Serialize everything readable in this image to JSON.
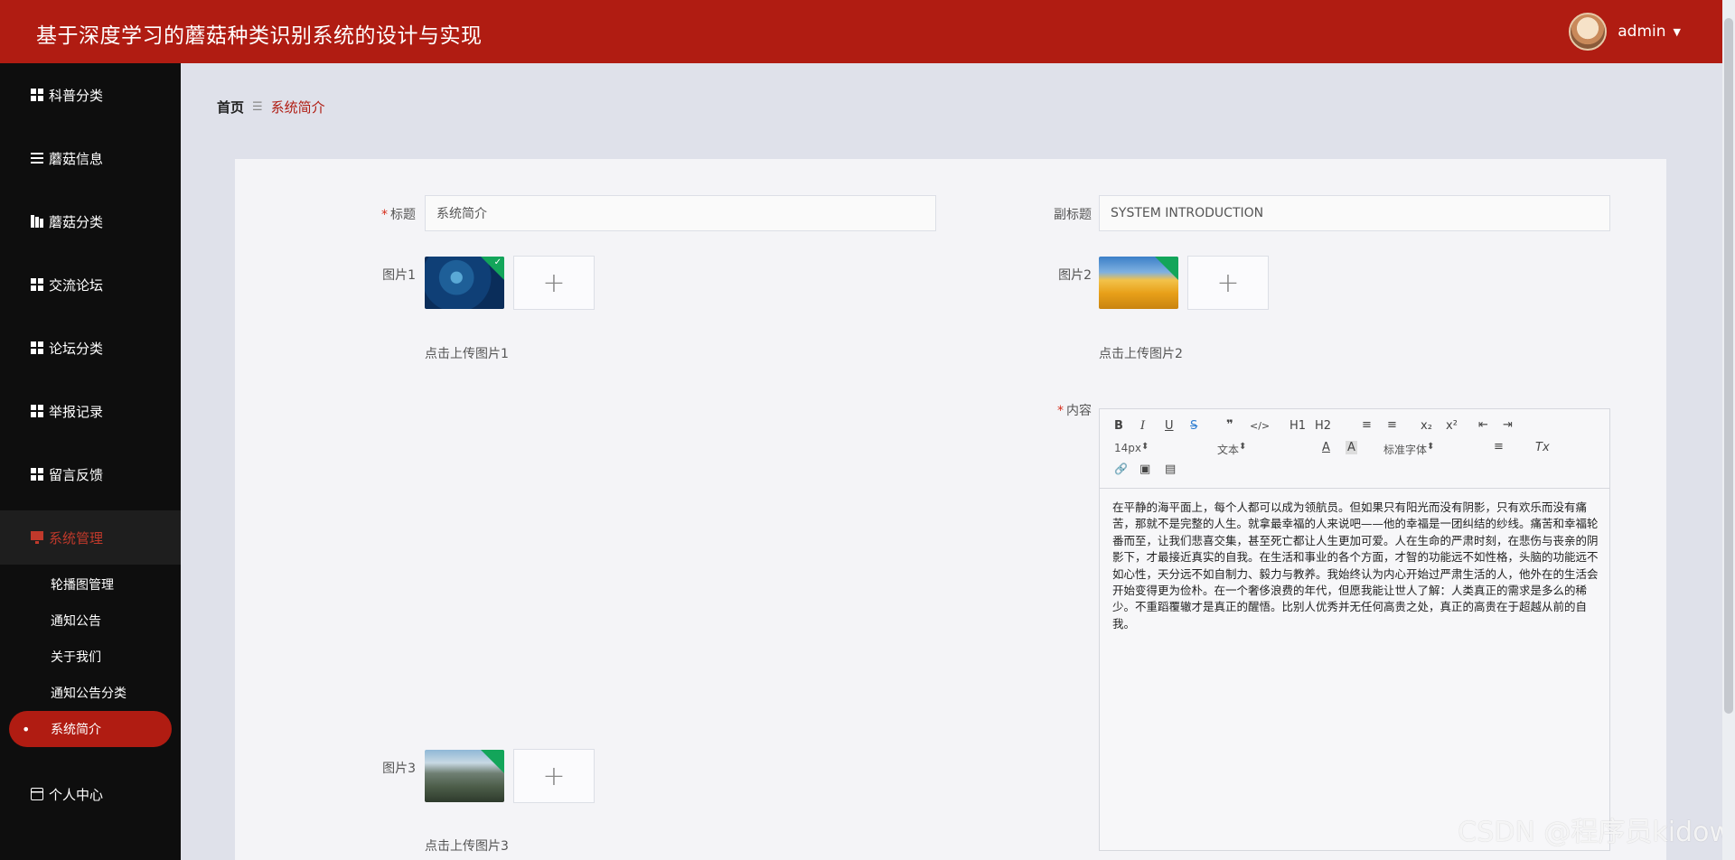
{
  "app": {
    "title": "基于深度学习的蘑菇种类识别系统的设计与实现",
    "user": "admin"
  },
  "sidebar": {
    "items": [
      {
        "label": "科普分类",
        "icon": "grid-icon"
      },
      {
        "label": "蘑菇信息",
        "icon": "list-icon"
      },
      {
        "label": "蘑菇分类",
        "icon": "book-icon"
      },
      {
        "label": "交流论坛",
        "icon": "grid-icon"
      },
      {
        "label": "论坛分类",
        "icon": "grid-icon"
      },
      {
        "label": "举报记录",
        "icon": "grid-icon"
      },
      {
        "label": "留言反馈",
        "icon": "grid-icon"
      },
      {
        "label": "系统管理",
        "icon": "monitor-icon"
      },
      {
        "label": "个人中心",
        "icon": "card-icon"
      }
    ],
    "sub_items": [
      "轮播图管理",
      "通知公告",
      "关于我们",
      "通知公告分类",
      "系统简介"
    ]
  },
  "breadcrumb": {
    "home": "首页",
    "separator": "☰",
    "current": "系统简介"
  },
  "form": {
    "title_label": "标题",
    "title_value": "系统简介",
    "subtitle_label": "副标题",
    "subtitle_value": "SYSTEM INTRODUCTION",
    "image1_label": "图片1",
    "image2_label": "图片2",
    "image3_label": "图片3",
    "image1_hint": "点击上传图片1",
    "image2_hint": "点击上传图片2",
    "image3_hint": "点击上传图片3",
    "content_label": "内容",
    "upload_plus": "+"
  },
  "editor": {
    "font_size": "14px",
    "block_type": "文本",
    "font_family": "标准字体",
    "tools": {
      "bold": "B",
      "italic": "I",
      "underline": "U",
      "strike": "S",
      "quote": "❞",
      "code": "</>",
      "h1": "H1",
      "h2": "H2",
      "ol": "≡",
      "ul": "≡",
      "sub": "x₂",
      "sup": "x²",
      "outdent": "⇤",
      "indent": "⇥",
      "color": "A",
      "bg": "A",
      "align": "≡",
      "clean": "Tx",
      "link": "🔗",
      "image": "▣",
      "video": "▤"
    },
    "content": "在平静的海平面上，每个人都可以成为领航员。但如果只有阳光而没有阴影，只有欢乐而没有痛苦，那就不是完整的人生。就拿最幸福的人来说吧——他的幸福是一团纠结的纱线。痛苦和幸福轮番而至，让我们悲喜交集，甚至死亡都让人生更加可爱。人在生命的严肃时刻，在悲伤与丧亲的阴影下，才最接近真实的自我。在生活和事业的各个方面，才智的功能远不如性格，头脑的功能远不如心性，天分远不如自制力、毅力与教养。我始终认为内心开始过严肃生活的人，他外在的生活会开始变得更为俭朴。在一个奢侈浪费的年代，但愿我能让世人了解：人类真正的需求是多么的稀少。不重蹈覆辙才是真正的醒悟。比别人优秀并无任何高贵之处，真正的高贵在于超越从前的自我。"
  },
  "watermark": "CSDN @程序员kidow"
}
